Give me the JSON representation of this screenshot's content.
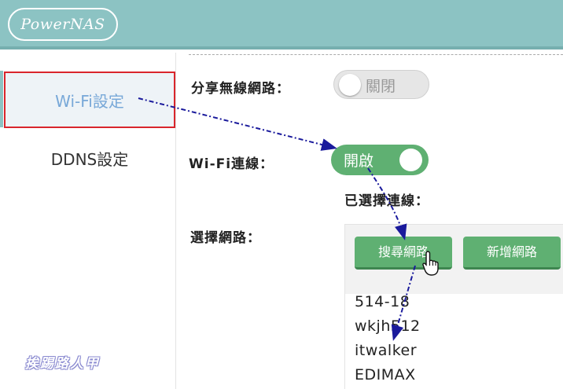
{
  "header": {
    "logo_text": "PowerNAS"
  },
  "sidebar": {
    "items": [
      {
        "label": "Wi-Fi設定"
      },
      {
        "label": "DDNS設定"
      }
    ]
  },
  "wireless_share": {
    "label": "分享無線網路：",
    "toggle_text": "關閉"
  },
  "wifi_connection": {
    "label": "Wi-Fi連線：",
    "toggle_text": "開啟"
  },
  "selected_connection": {
    "label": "已選擇連線："
  },
  "network_select": {
    "label": "選擇網路：",
    "search_button": "搜尋網路",
    "add_button": "新增網路",
    "networks": [
      "514-18",
      "wkjh512",
      "itwalker",
      "EDIMAX"
    ]
  },
  "watermark": "挨踢路人甲",
  "colors": {
    "header": "#8cc3c3",
    "accent_green": "#5fb072",
    "annotation_red": "#d9252c",
    "arrow_blue": "#1a1a9c"
  }
}
